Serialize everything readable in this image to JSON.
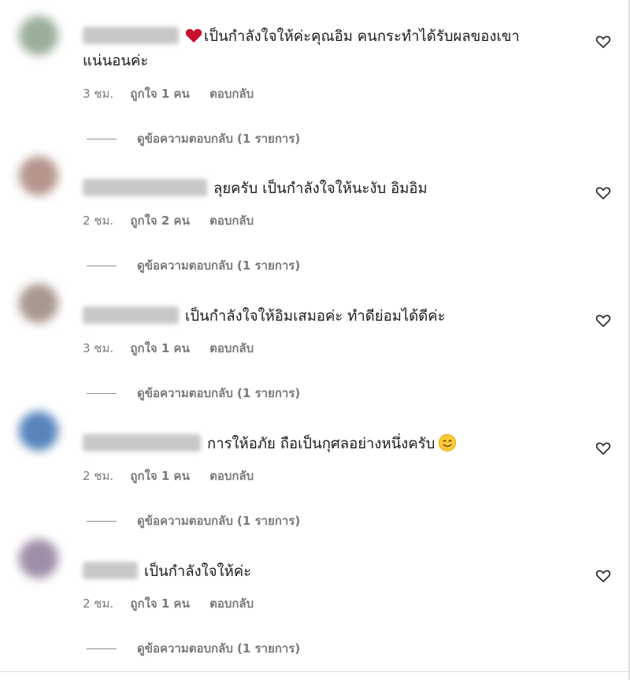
{
  "colors": {
    "avatar_1": "#8aa08a",
    "avatar_2": "#a88478",
    "avatar_3": "#9a857c",
    "avatar_4": "#3b6fb0",
    "avatar_5": "#8d7a98",
    "red_heart": "#c8102e"
  },
  "comments": [
    {
      "text_line1": "เป็นกำลังใจให้ค่ะคุณอิม คนกระทำได้รับผลของเขา",
      "text_line2": "แน่นอนค่ะ",
      "has_heart_emoji": true,
      "time": "3 ชม.",
      "likes": "ถูกใจ 1 คน",
      "reply": "ตอบกลับ",
      "view_replies": "ดูข้อความตอบกลับ (1 รายการ)",
      "like_icon": "heart-outline-icon"
    },
    {
      "text_line1": "ลุยครับ เป็นกำลังใจให้นะงับ อิมอิม",
      "time": "2 ชม.",
      "likes": "ถูกใจ 2 คน",
      "reply": "ตอบกลับ",
      "view_replies": "ดูข้อความตอบกลับ (1 รายการ)",
      "like_icon": "heart-outline-icon"
    },
    {
      "text_line1": "เป็นกำลังใจให้อิมเสมอค่ะ ทำดีย่อมได้ดีค่ะ",
      "time": "3 ชม.",
      "likes": "ถูกใจ 1 คน",
      "reply": "ตอบกลับ",
      "view_replies": "ดูข้อความตอบกลับ (1 รายการ)",
      "like_icon": "heart-outline-icon"
    },
    {
      "text_line1": "การให้อภัย ถือเป็นกุศลอย่างหนึ่งครับ",
      "has_smile_emoji": true,
      "time": "2 ชม.",
      "likes": "ถูกใจ 1 คน",
      "reply": "ตอบกลับ",
      "view_replies": "ดูข้อความตอบกลับ (1 รายการ)",
      "like_icon": "heart-outline-icon"
    },
    {
      "text_line1": "เป็นกำลังใจให้ค่ะ",
      "time": "2 ชม.",
      "likes": "ถูกใจ 1 คน",
      "reply": "ตอบกลับ",
      "view_replies": "ดูข้อความตอบกลับ (1 รายการ)",
      "like_icon": "heart-outline-icon"
    }
  ]
}
